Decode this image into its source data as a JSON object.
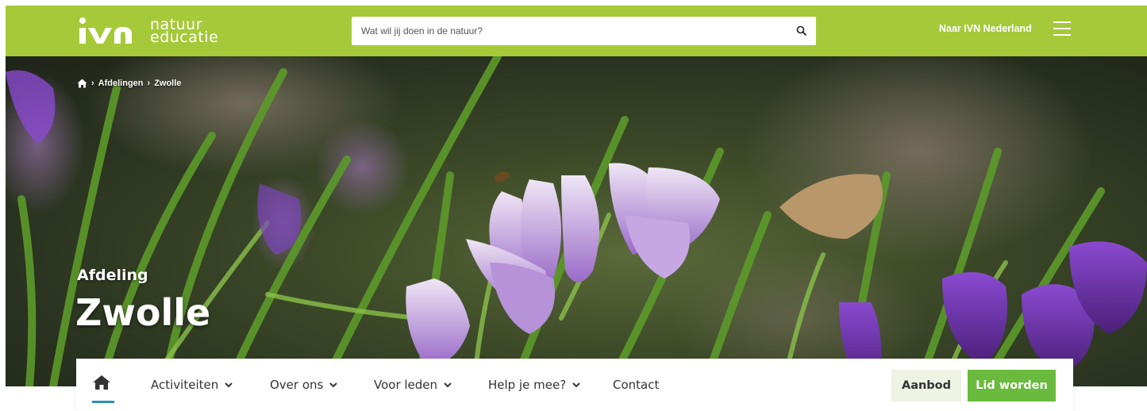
{
  "header": {
    "logo_brand": "ivn",
    "logo_line1": "natuur",
    "logo_line2": "educatie",
    "search_placeholder": "Wat wil jij doen in de natuur?",
    "search_icon": "search-icon",
    "naar_link": "Naar IVN Nederland",
    "menu_icon": "hamburger-menu-icon",
    "brand_color": "#a6c93a"
  },
  "breadcrumb": {
    "home_icon": "home-icon",
    "items": [
      "Afdelingen",
      "Zwolle"
    ],
    "separator": "›"
  },
  "hero": {
    "subtitle": "Afdeling",
    "title": "Zwolle"
  },
  "nav": {
    "home_icon": "home-icon",
    "items": [
      {
        "label": "Activiteiten",
        "has_dropdown": true
      },
      {
        "label": "Over ons",
        "has_dropdown": true
      },
      {
        "label": "Voor leden",
        "has_dropdown": true
      },
      {
        "label": "Help je mee?",
        "has_dropdown": true
      },
      {
        "label": "Contact",
        "has_dropdown": false
      }
    ],
    "aanbod_label": "Aanbod",
    "lid_label": "Lid worden",
    "accent_color": "#6aba3e"
  }
}
